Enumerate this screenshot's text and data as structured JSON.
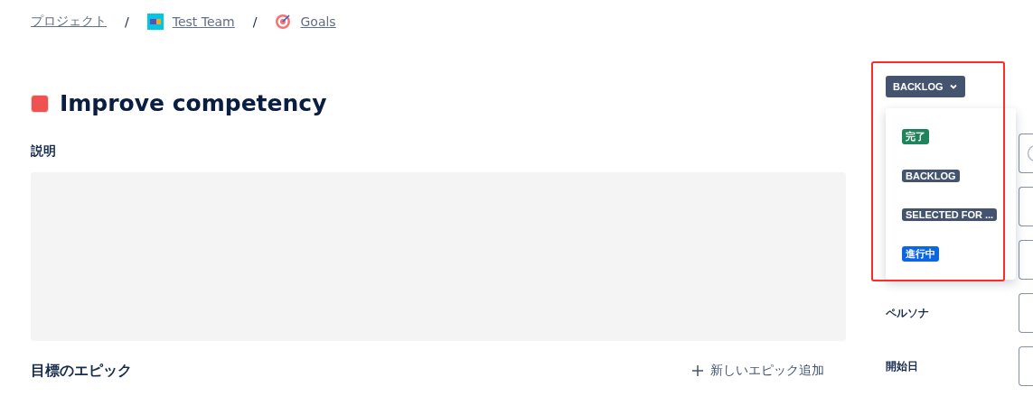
{
  "breadcrumbs": [
    {
      "label": "プロジェクト"
    },
    {
      "label": "Test Team"
    },
    {
      "label": "Goals"
    }
  ],
  "breadcrumb_separator": "/",
  "title": {
    "text": "Improve competency",
    "color": "#f05252"
  },
  "description": {
    "label": "説明"
  },
  "epics": {
    "label": "目標のエピック",
    "add_button": "新しいエピック追加"
  },
  "status": {
    "label": "BACKLOG",
    "expanded": true
  },
  "status_options": [
    {
      "label": "完了",
      "color": "#1f845a"
    },
    {
      "label": "BACKLOG",
      "color": "#44546f"
    },
    {
      "label": "SELECTED FOR ...",
      "color": "#44546f"
    },
    {
      "label": "進行中",
      "color": "#0c66e4"
    }
  ],
  "fields": [
    {
      "kind": "avatar"
    },
    {
      "kind": "text"
    },
    {
      "kind": "text"
    },
    {
      "label": "ペルソナ",
      "kind": "text"
    },
    {
      "label": "開始日",
      "kind": "text"
    }
  ]
}
